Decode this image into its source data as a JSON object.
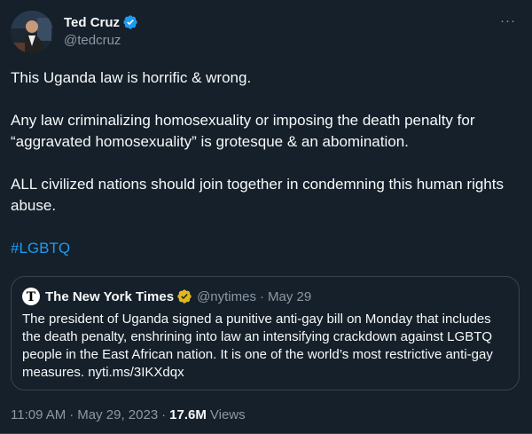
{
  "author": {
    "display_name": "Ted Cruz",
    "handle": "@tedcruz"
  },
  "more_label": "···",
  "tweet": {
    "paragraphs": [
      "This Uganda law is horrific & wrong.",
      "Any law criminalizing homosexuality or imposing the death penalty for “aggravated homosexuality” is grotesque & an abomination.",
      "ALL civilized nations should join together in condemning this human rights abuse."
    ],
    "hashtag": "#LGBTQ"
  },
  "quote": {
    "display_name": "The New York Times",
    "handle": "@nytimes",
    "separator": "·",
    "date": "May 29",
    "text": "The president of Uganda signed a punitive anti-gay bill on Monday that includes the death penalty, enshrining into law an intensifying crackdown against LGBTQ people in the East African nation. It is one of the world’s most restrictive anti-gay measures. nyti.ms/3IKXdqx"
  },
  "meta": {
    "time": "11:09 AM",
    "separator": "·",
    "date": "May 29, 2023",
    "separator2": "·",
    "views_count": "17.6M",
    "views_label": "Views"
  },
  "colors": {
    "background": "#15202b",
    "text": "#f7f9f9",
    "muted": "#8b98a5",
    "link": "#1d9bf0",
    "verified_blue": "#1d9bf0",
    "verified_gold": "#e2b719",
    "border": "#38444d"
  },
  "icons": {
    "author_badge": "verified-badge-icon",
    "quote_badge": "gold-verified-badge-icon",
    "quote_logo": "nyt-logo-icon"
  }
}
